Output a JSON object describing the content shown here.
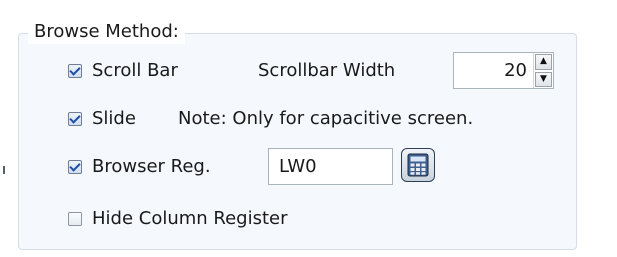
{
  "group": {
    "title": "Browse Method:"
  },
  "options": {
    "scroll_bar": {
      "label": "Scroll Bar",
      "checked": true
    },
    "scrollbar_width": {
      "label": "Scrollbar Width",
      "value": "20"
    },
    "slide": {
      "label": "Slide",
      "checked": true,
      "note": "Note: Only for capacitive screen."
    },
    "browser_reg": {
      "label": "Browser Reg.",
      "checked": true,
      "value": "LW0"
    },
    "hide_column_register": {
      "label": "Hide Column Register",
      "checked": false
    }
  },
  "icons": {
    "spin_up": "spin-up-arrow-icon",
    "spin_down": "spin-down-arrow-icon",
    "calculator": "calculator-icon"
  },
  "colors": {
    "group_background": "#f5f8fc",
    "group_border": "#d6dde6",
    "check_mark": "#1f4fa3"
  }
}
